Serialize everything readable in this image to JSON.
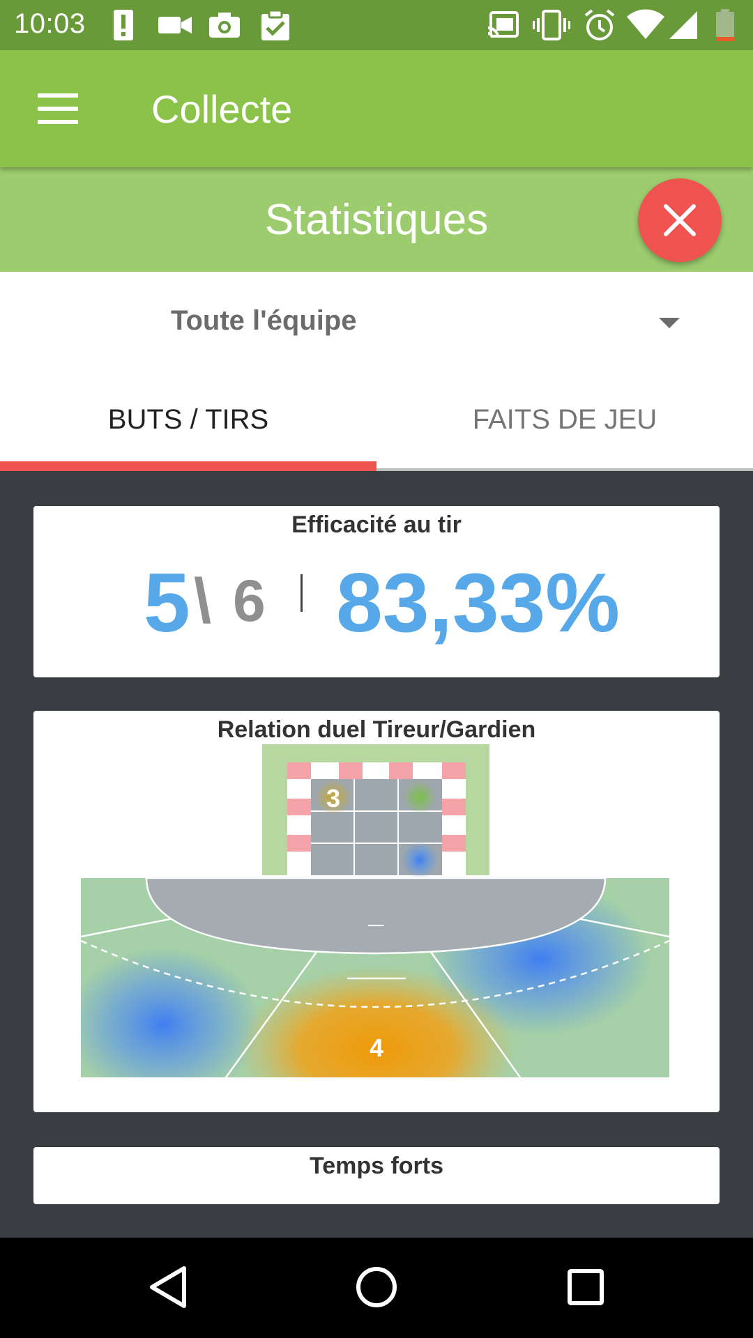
{
  "status_bar": {
    "time": "10:03",
    "icons_left": [
      "alert-icon",
      "video-icon",
      "camera-icon",
      "clipboard-check-icon"
    ],
    "icons_right": [
      "cast-icon",
      "vibrate-icon",
      "alarm-icon",
      "wifi-icon",
      "signal-icon",
      "battery-low-icon"
    ]
  },
  "app_bar": {
    "title": "Collecte",
    "menu_icon": "hamburger-menu-icon"
  },
  "sub_header": {
    "title": "Statistiques",
    "close_icon": "close-icon"
  },
  "filter": {
    "selected": "Toute l'équipe",
    "caret_icon": "dropdown-caret-icon"
  },
  "tabs": [
    {
      "label": "BUTS / TIRS",
      "active": true
    },
    {
      "label": "FAITS DE JEU",
      "active": false
    }
  ],
  "efficiency": {
    "title": "Efficacité au tir",
    "goals": "5",
    "separator": "\\",
    "shots": "6",
    "percentage": "83,33%"
  },
  "duel": {
    "title": "Relation duel Tireur/Gardien",
    "goal_zone_labels": [
      "3"
    ],
    "court_zone_labels": [
      "4"
    ]
  },
  "temps_forts": {
    "title": "Temps forts"
  },
  "nav_bar": {
    "buttons": [
      "back-icon",
      "home-icon",
      "recents-icon"
    ]
  },
  "colors": {
    "status_bar": "#689a39",
    "app_bar": "#8bc34a",
    "sub_header": "#9ccc6e",
    "accent_red": "#ef5350",
    "stat_blue": "#56a8e8",
    "court_green": "#a5d0a8",
    "background": "#3a3d41"
  }
}
